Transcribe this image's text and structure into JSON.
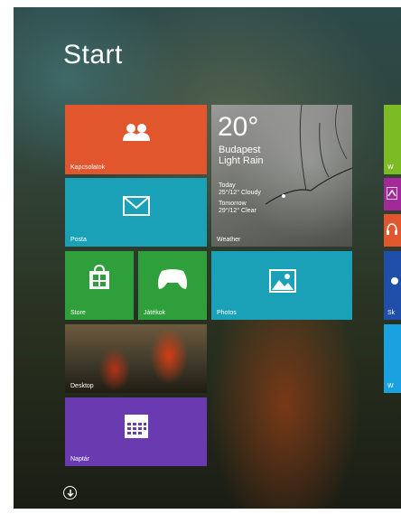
{
  "start": {
    "title": "Start"
  },
  "tiles": {
    "contacts": {
      "label": "Kapcsolatok",
      "icon": "people-icon",
      "color": "#e2562d"
    },
    "weather": {
      "temp": "20°",
      "city": "Budapest",
      "condition": "Light Rain",
      "today_label": "Today",
      "today_forecast": "25°/12° Cloudy",
      "tomorrow_label": "Tomorrow",
      "tomorrow_forecast": "29°/12° Clear",
      "label": "Weather"
    },
    "mail": {
      "label": "Posta",
      "icon": "mail-icon",
      "color": "#1aa1b8"
    },
    "store": {
      "label": "Store",
      "icon": "store-bag-icon",
      "color": "#2e9f3a"
    },
    "games": {
      "label": "Játékok",
      "icon": "gamepad-icon",
      "color": "#2e9f3a"
    },
    "photos": {
      "label": "Photos",
      "icon": "photo-icon",
      "color": "#1aa1b8"
    },
    "desktop": {
      "label": "Desktop"
    },
    "calendar": {
      "label": "Naptár",
      "icon": "calendar-icon",
      "color": "#6a3ab0"
    }
  },
  "edge_tiles": {
    "top_label": "W",
    "skype_label": "Sk",
    "bottom_label": "W"
  }
}
